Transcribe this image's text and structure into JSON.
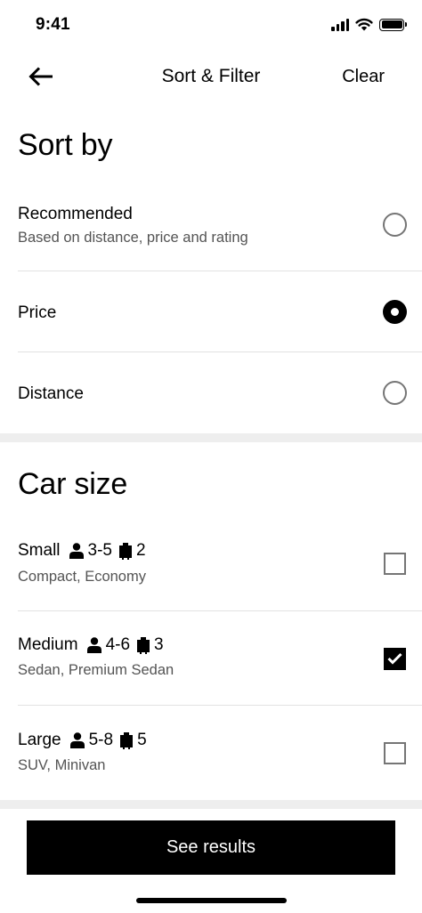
{
  "status_bar": {
    "time": "9:41",
    "icons": [
      "signal-icon",
      "wifi-icon",
      "battery-icon"
    ]
  },
  "nav": {
    "title": "Sort & Filter",
    "clear_label": "Clear",
    "back_icon": "arrow-left-icon"
  },
  "sort": {
    "title": "Sort by",
    "options": [
      {
        "label": "Recommended",
        "subtitle": "Based on distance, price and rating",
        "selected": false
      },
      {
        "label": "Price",
        "subtitle": "",
        "selected": true
      },
      {
        "label": "Distance",
        "subtitle": "",
        "selected": false
      }
    ]
  },
  "car_size": {
    "title": "Car size",
    "options": [
      {
        "label": "Small",
        "passengers": "3-5",
        "luggage": "2",
        "subtitle": "Compact, Economy",
        "checked": false
      },
      {
        "label": "Medium",
        "passengers": "4-6",
        "luggage": "3",
        "subtitle": "Sedan, Premium Sedan",
        "checked": true
      },
      {
        "label": "Large",
        "passengers": "5-8",
        "luggage": "5",
        "subtitle": "SUV, Minivan",
        "checked": false
      }
    ]
  },
  "footer": {
    "button_label": "See results"
  },
  "colors": {
    "primary": "#000000",
    "secondary_text": "#545454",
    "divider": "#e2e2e2",
    "section_gap": "#eeeeee",
    "unselected_control": "#757575"
  }
}
